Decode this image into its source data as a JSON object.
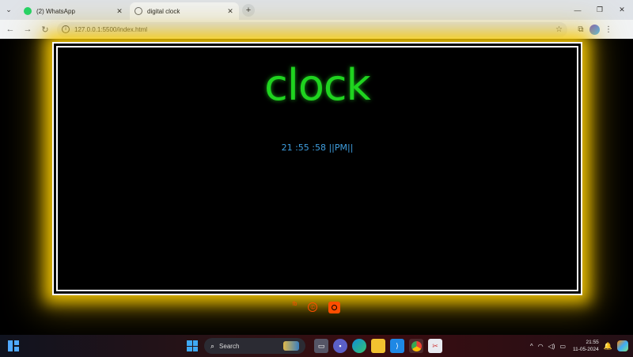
{
  "browser": {
    "tabs": [
      {
        "title": "(2) WhatsApp",
        "icon": "whatsapp-icon",
        "active": false
      },
      {
        "title": "digital clock",
        "icon": "globe-icon",
        "active": true
      }
    ],
    "address": "127.0.0.1:5500/index.html"
  },
  "page": {
    "heading": "clock",
    "time": "21 :55 :58 ||PM||"
  },
  "colors": {
    "heading": "#1fd31f",
    "time": "#3f9fe0",
    "glow": "#ffd000",
    "footer_icons": "#ff4d00"
  },
  "taskbar": {
    "search_placeholder": "Search",
    "clock_time": "21:55",
    "clock_date": "11-05-2024"
  }
}
